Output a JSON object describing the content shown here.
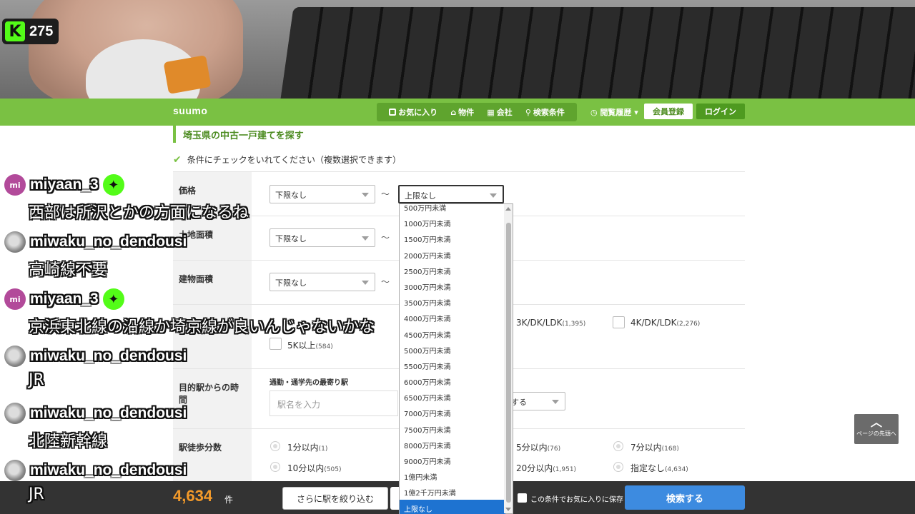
{
  "stream": {
    "viewer_count": "275",
    "platform_logo": "K"
  },
  "site": {
    "logo": "suumo",
    "nav": [
      "お気に入り",
      "物件",
      "会社",
      "検索条件"
    ],
    "history": "閲覧履歴 ▾",
    "register": "会員登録",
    "login": "ログイン"
  },
  "page": {
    "title": "埼玉県の中古一戸建てを探す",
    "instruction": "条件にチェックをいれてください（複数選択できます）"
  },
  "form": {
    "price_label": "価格",
    "price_min": "下限なし",
    "price_max": "上限なし",
    "land_label": "土地面積",
    "land_min": "下限なし",
    "building_label": "建物面積",
    "building_min": "下限なし",
    "tilde": "〜",
    "layouts": [
      {
        "text": "3K/DK/LDK",
        "count": "(1,395)"
      },
      {
        "text": "4K/DK/LDK",
        "count": "(2,276)"
      },
      {
        "text": "5K以上",
        "count": "(584)"
      }
    ],
    "station_time_label": "目的駅からの時間",
    "station_sub_label": "通勤・通学先の最寄り駅",
    "station_placeholder": "駅名を入力",
    "station_select": "する",
    "walk_label": "駅徒歩分数",
    "walk_options": [
      {
        "text": "1分以内",
        "count": "(1)"
      },
      {
        "text": "5分以内",
        "count": "(76)"
      },
      {
        "text": "7分以内",
        "count": "(168)"
      },
      {
        "text": "10分以内",
        "count": "(505)"
      },
      {
        "text": "20分以内",
        "count": "(1,951)"
      },
      {
        "text": "指定なし",
        "count": "(4,634)"
      }
    ]
  },
  "price_dropdown": {
    "options": [
      "500万円未満",
      "1000万円未満",
      "1500万円未満",
      "2000万円未満",
      "2500万円未満",
      "3000万円未満",
      "3500万円未満",
      "4000万円未満",
      "4500万円未満",
      "5000万円未満",
      "5500万円未満",
      "6000万円未満",
      "6500万円未満",
      "7000万円未満",
      "7500万円未満",
      "8000万円未満",
      "9000万円未満",
      "1億円未満",
      "1億2千万円未満",
      "上限なし"
    ],
    "selected": "上限なし"
  },
  "footer": {
    "count": "4,634",
    "unit": "件",
    "narrow_button": "さらに駅を絞り込む",
    "save_label": "この条件でお気に入りに保存",
    "search_button": "検索する",
    "to_top": "ページの先頭へ"
  },
  "chat": [
    {
      "user": "miyaan_3",
      "avatar": "mi",
      "badge": true,
      "text": "西部は所沢とかの方面になるね"
    },
    {
      "user": "miwaku_no_dendousi",
      "avatar": "",
      "badge": false,
      "text": "高崎線不要"
    },
    {
      "user": "miyaan_3",
      "avatar": "mi",
      "badge": true,
      "text": "京浜東北線の沿線か埼京線が良いんじゃないかな"
    },
    {
      "user": "miwaku_no_dendousi",
      "avatar": "",
      "badge": false,
      "text": "JR"
    },
    {
      "user": "miwaku_no_dendousi",
      "avatar": "",
      "badge": false,
      "text": "北陸新幹線"
    },
    {
      "user": "miwaku_no_dendousi",
      "avatar": "",
      "badge": false,
      "text": "JR"
    }
  ],
  "colors": {
    "brand_green": "#7ac143",
    "accent_orange": "#f39a2a",
    "search_blue": "#3d8be0",
    "kick_green": "#53fc18"
  }
}
